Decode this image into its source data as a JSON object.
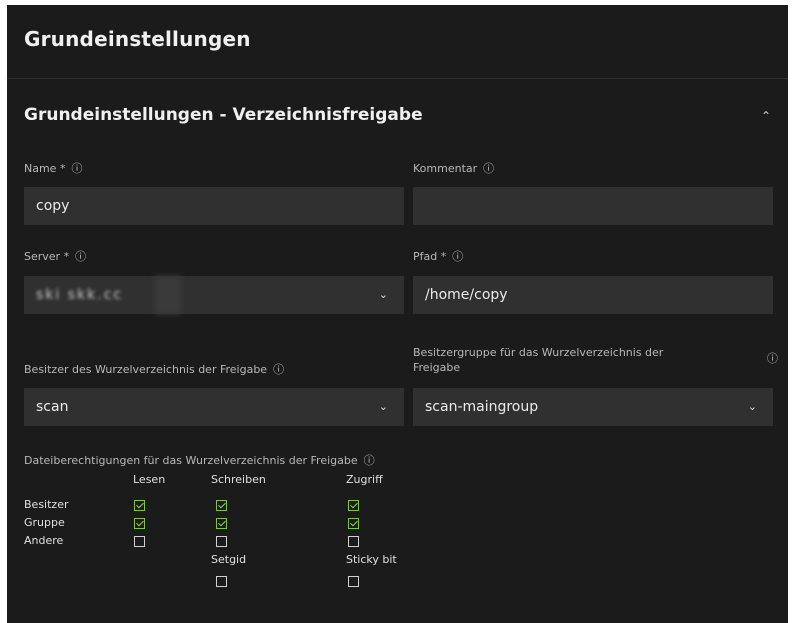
{
  "page": {
    "title": "Grundeinstellungen"
  },
  "section": {
    "title": "Grundeinstellungen - Verzeichnisfreigabe",
    "collapse_icon": "chevron-up-icon"
  },
  "form": {
    "name": {
      "label": "Name *",
      "value": "copy"
    },
    "kommentar": {
      "label": "Kommentar",
      "value": ""
    },
    "server": {
      "label": "Server *",
      "value": "ski skk.cc"
    },
    "pfad": {
      "label": "Pfad *",
      "value": "/home/copy"
    },
    "besitzer": {
      "label": "Besitzer des Wurzelverzeichnis der Freigabe",
      "value": "scan"
    },
    "gruppe": {
      "label_line1": "Besitzergruppe für das Wurzelverzeichnis der",
      "label_line2": "Freigabe",
      "value": "scan-maingroup"
    }
  },
  "permissions": {
    "label": "Dateiberechtigungen für das Wurzelverzeichnis der Freigabe",
    "columns": [
      "Lesen",
      "Schreiben",
      "Zugriff"
    ],
    "rows": [
      {
        "name": "Besitzer",
        "checks": [
          true,
          true,
          true
        ]
      },
      {
        "name": "Gruppe",
        "checks": [
          true,
          true,
          true
        ]
      },
      {
        "name": "Andere",
        "checks": [
          false,
          false,
          false
        ]
      }
    ],
    "extra": [
      {
        "name": "Setgid",
        "checked": false
      },
      {
        "name": "Sticky bit",
        "checked": false
      }
    ]
  },
  "colors": {
    "background": "#1b1b1b",
    "field": "#303030",
    "checked": "#7fc34a"
  }
}
